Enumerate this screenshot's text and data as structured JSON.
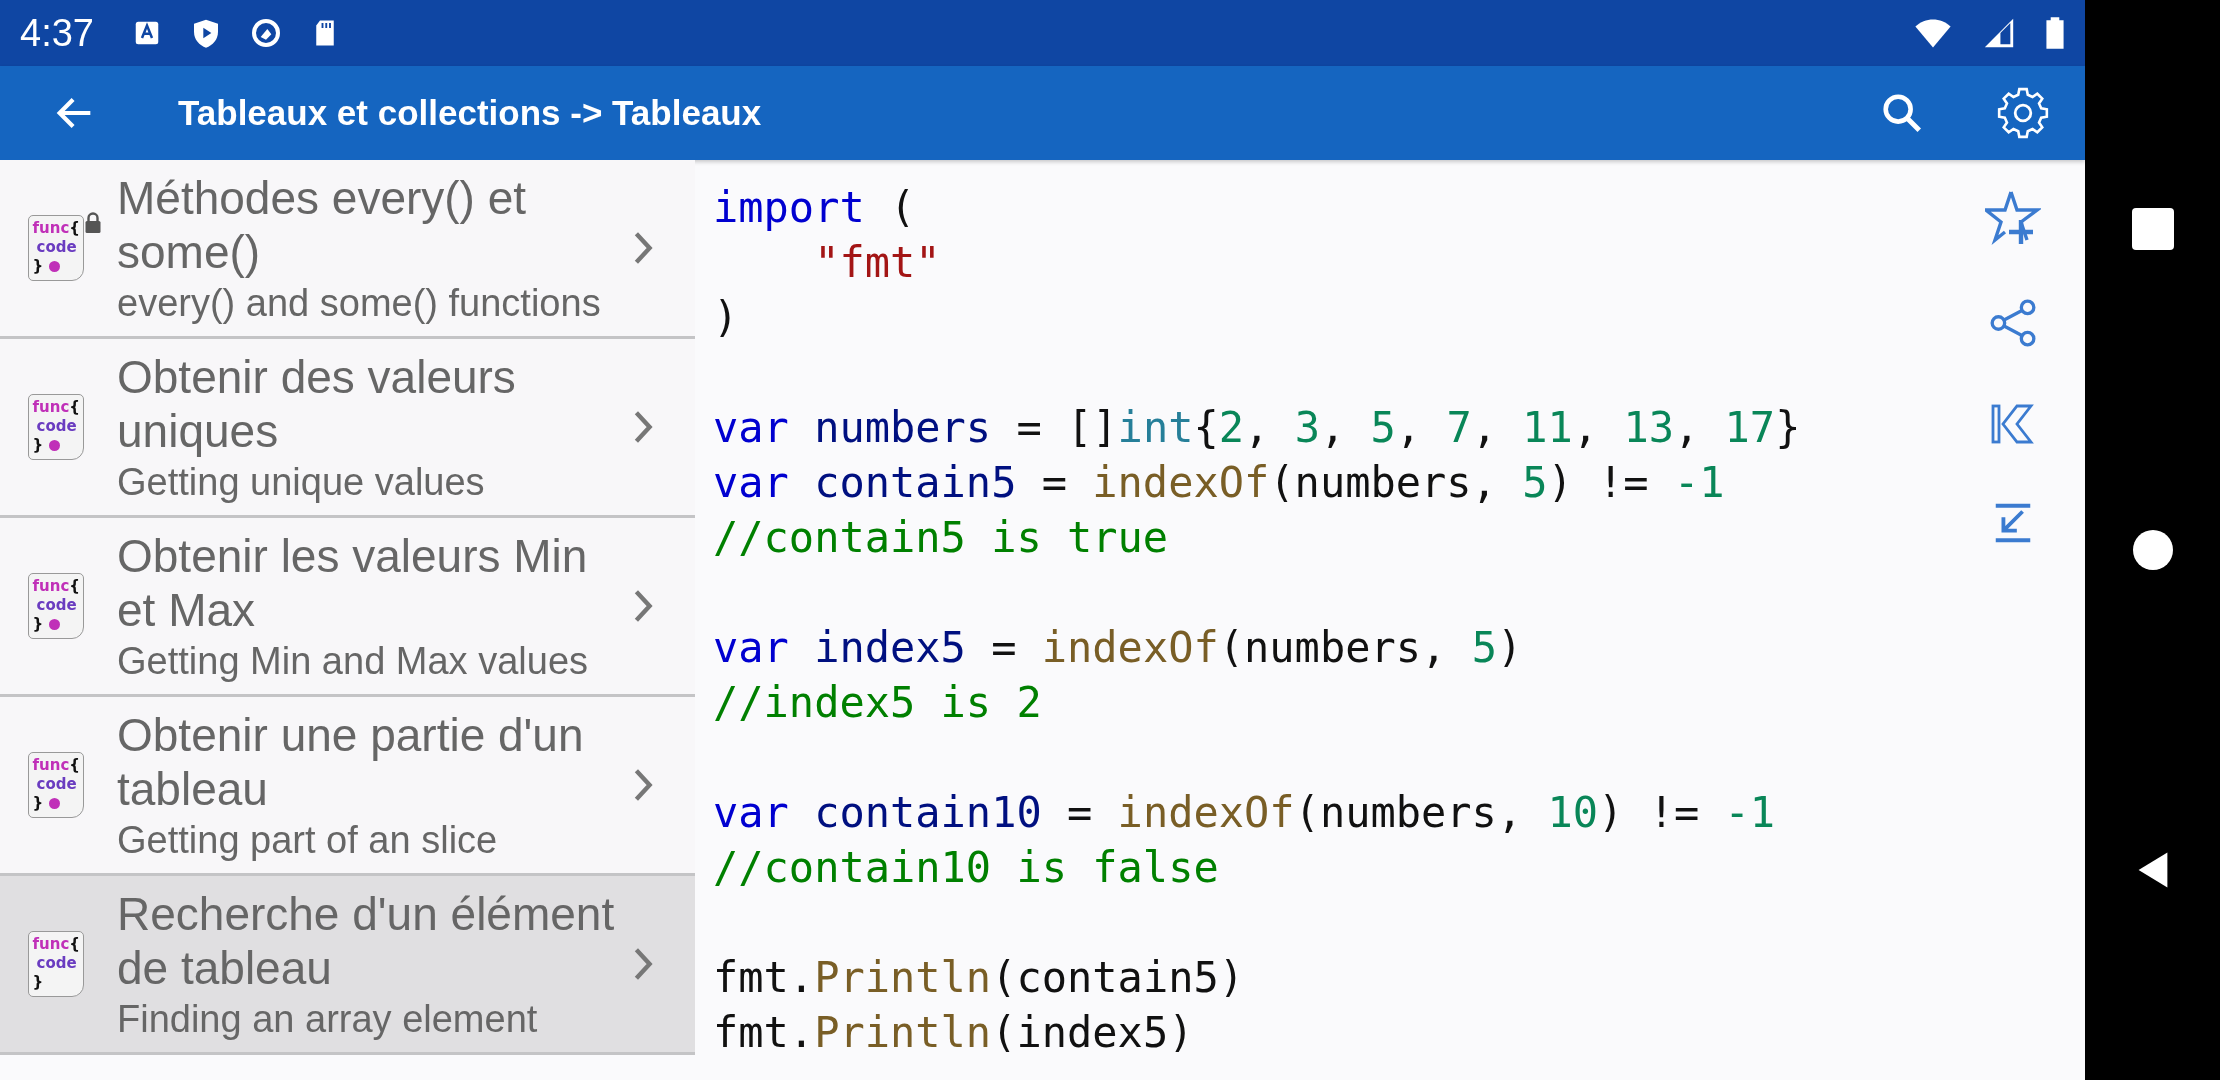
{
  "status_bar": {
    "time": "4:37"
  },
  "app_bar": {
    "title": "Tableaux et collections -> Tableaux"
  },
  "list": [
    {
      "title": "Méthodes every() et some()",
      "subtitle": "every() and some() functions",
      "icon_text": [
        "func",
        "{",
        "code",
        "}"
      ],
      "dot": true,
      "locked": true,
      "selected": false
    },
    {
      "title": "Obtenir des valeurs uniques",
      "subtitle": "Getting unique values",
      "icon_text": [
        "func",
        "{",
        "code",
        "}"
      ],
      "dot": true,
      "locked": false,
      "selected": false
    },
    {
      "title": "Obtenir les valeurs Min et Max",
      "subtitle": "Getting Min and Max values",
      "icon_text": [
        "func",
        "{",
        "code",
        "}"
      ],
      "dot": true,
      "locked": false,
      "selected": false
    },
    {
      "title": "Obtenir une partie d'un tableau",
      "subtitle": "Getting part of an slice",
      "icon_text": [
        "func",
        "{",
        "code",
        "}"
      ],
      "dot": true,
      "locked": false,
      "selected": false
    },
    {
      "title": "Recherche d'un élément de tableau",
      "subtitle": "Finding an array element",
      "icon_text": [
        "func",
        "{",
        "code",
        "}"
      ],
      "dot": false,
      "locked": false,
      "selected": true
    }
  ],
  "code_blocks": [
    [
      [
        {
          "t": "import",
          "kind": "kw"
        },
        {
          "t": " (",
          "kind": "plain"
        }
      ],
      [
        {
          "t": "    \"fmt\"",
          "kind": "str"
        }
      ],
      [
        {
          "t": ")",
          "kind": "plain"
        }
      ]
    ],
    [
      [
        {
          "t": "var",
          "kind": "kw"
        },
        {
          "t": " numbers",
          "kind": "var"
        },
        {
          "t": " = []",
          "kind": "plain"
        },
        {
          "t": "int",
          "kind": "type"
        },
        {
          "t": "{",
          "kind": "plain"
        },
        {
          "t": "2",
          "kind": "num"
        },
        {
          "t": ", ",
          "kind": "plain"
        },
        {
          "t": "3",
          "kind": "num"
        },
        {
          "t": ", ",
          "kind": "plain"
        },
        {
          "t": "5",
          "kind": "num"
        },
        {
          "t": ", ",
          "kind": "plain"
        },
        {
          "t": "7",
          "kind": "num"
        },
        {
          "t": ", ",
          "kind": "plain"
        },
        {
          "t": "11",
          "kind": "num"
        },
        {
          "t": ", ",
          "kind": "plain"
        },
        {
          "t": "13",
          "kind": "num"
        },
        {
          "t": ", ",
          "kind": "plain"
        },
        {
          "t": "17",
          "kind": "num"
        },
        {
          "t": "}",
          "kind": "plain"
        }
      ],
      [
        {
          "t": "var",
          "kind": "kw"
        },
        {
          "t": " contain5",
          "kind": "var"
        },
        {
          "t": " = ",
          "kind": "plain"
        },
        {
          "t": "indexOf",
          "kind": "fn"
        },
        {
          "t": "(numbers, ",
          "kind": "plain"
        },
        {
          "t": "5",
          "kind": "num"
        },
        {
          "t": ") != ",
          "kind": "plain"
        },
        {
          "t": "-1",
          "kind": "num"
        }
      ],
      [
        {
          "t": "//contain5 is true",
          "kind": "comment"
        }
      ]
    ],
    [
      [
        {
          "t": "var",
          "kind": "kw"
        },
        {
          "t": " index5",
          "kind": "var"
        },
        {
          "t": " = ",
          "kind": "plain"
        },
        {
          "t": "indexOf",
          "kind": "fn"
        },
        {
          "t": "(numbers, ",
          "kind": "plain"
        },
        {
          "t": "5",
          "kind": "num"
        },
        {
          "t": ")",
          "kind": "plain"
        }
      ],
      [
        {
          "t": "//index5 is 2",
          "kind": "comment"
        }
      ]
    ],
    [
      [
        {
          "t": "var",
          "kind": "kw"
        },
        {
          "t": " contain10",
          "kind": "var"
        },
        {
          "t": " = ",
          "kind": "plain"
        },
        {
          "t": "indexOf",
          "kind": "fn"
        },
        {
          "t": "(numbers, ",
          "kind": "plain"
        },
        {
          "t": "10",
          "kind": "num"
        },
        {
          "t": ") != ",
          "kind": "plain"
        },
        {
          "t": "-1",
          "kind": "num"
        }
      ],
      [
        {
          "t": "//contain10 is false",
          "kind": "comment"
        }
      ]
    ],
    [
      [
        {
          "t": "fmt.",
          "kind": "plain"
        },
        {
          "t": "Println",
          "kind": "fn"
        },
        {
          "t": "(contain5)",
          "kind": "plain"
        }
      ],
      [
        {
          "t": "fmt.",
          "kind": "plain"
        },
        {
          "t": "Println",
          "kind": "fn"
        },
        {
          "t": "(index5)",
          "kind": "plain"
        }
      ]
    ]
  ]
}
